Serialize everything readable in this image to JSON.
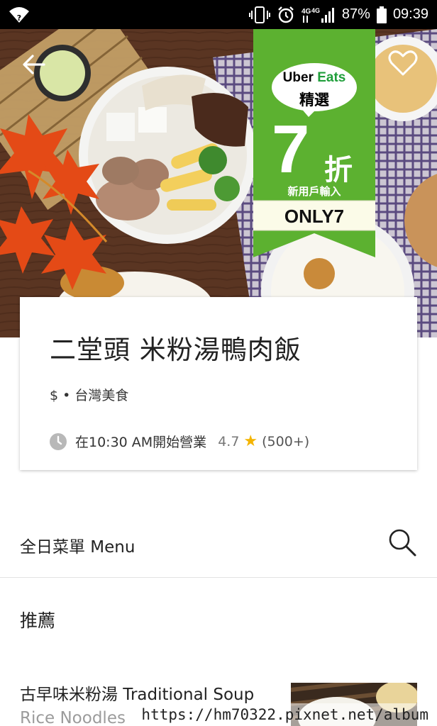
{
  "status_bar": {
    "battery": "87%",
    "time": "09:39",
    "network_label": "4G",
    "icons": [
      "wifi-icon",
      "vibrate-icon",
      "alarm-icon",
      "signal-icon",
      "battery-icon"
    ]
  },
  "hero": {
    "back_icon": "arrow-left-icon",
    "favorite_icon": "heart-outline-icon"
  },
  "promo": {
    "brand_uber": "Uber",
    "brand_eats": "Eats",
    "selection": "精選",
    "discount_number": "7",
    "discount_unit": "折",
    "new_user_text": "新用戶輸入",
    "promo_code": "ONLY7",
    "accent_color": "#5cb130"
  },
  "restaurant": {
    "name": "二堂頭 米粉湯鴨肉飯",
    "price_level": "$",
    "cuisine": "台灣美食",
    "hours": "在10:30 AM開始營業",
    "rating": "4.7",
    "rating_icon": "star-icon",
    "review_count": "(500+)"
  },
  "menu": {
    "title": "全日菜單 Menu",
    "search_icon": "search-icon",
    "sections": [
      {
        "title": "推薦"
      }
    ],
    "items": [
      {
        "title": "古早味米粉湯 Traditional Soup Rice Noodles"
      }
    ]
  },
  "watermark": "https://hm70322.pixnet.net/album"
}
